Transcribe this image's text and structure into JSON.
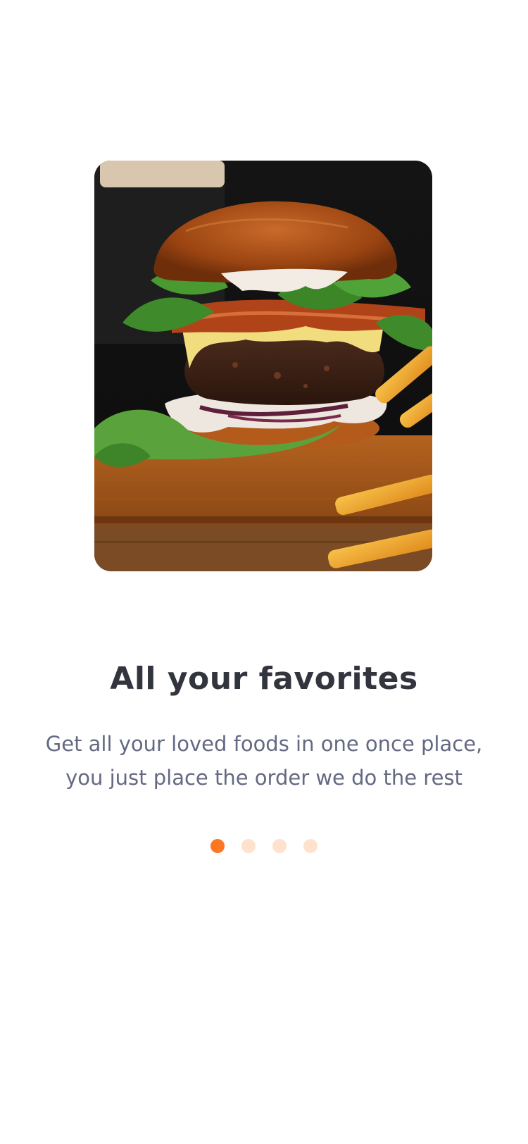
{
  "onboarding": {
    "image": {
      "name": "burger-photo",
      "description_icon": "burger-image"
    },
    "title": "All your favorites",
    "subtitle_lines": [
      "Get all your loved foods in one once place,",
      "you just place the order we do the rest"
    ],
    "pager": {
      "count": 4,
      "active_index": 0,
      "active_color": "#FF7622",
      "inactive_color": "#FFE1CE"
    }
  }
}
